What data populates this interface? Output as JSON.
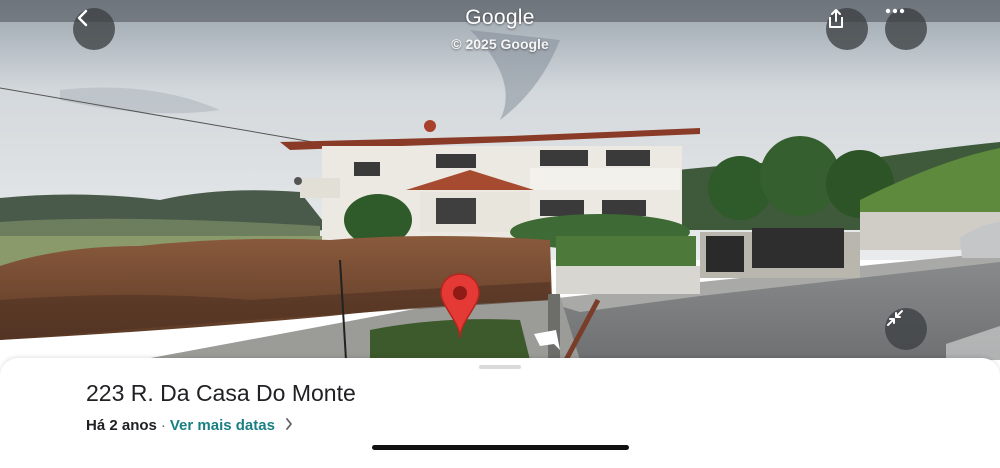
{
  "header": {
    "title": "Google",
    "copyright": "© 2025 Google",
    "back_icon": "chevron-left-icon",
    "share_icon": "share-icon",
    "more_icon": "more-horizontal-icon"
  },
  "viewer": {
    "pin_icon": "location-pin-icon",
    "minimize_icon": "collapse-arrows-icon"
  },
  "place": {
    "address": "223 R. Da Casa Do Monte",
    "age": "Há 2 anos",
    "separator": "·",
    "more_dates": "Ver mais datas",
    "chevron_icon": "chevron-right-icon"
  },
  "colors": {
    "accent_link": "#1a7f83",
    "pin_red": "#e53935",
    "button_bg": "#3c4043"
  }
}
